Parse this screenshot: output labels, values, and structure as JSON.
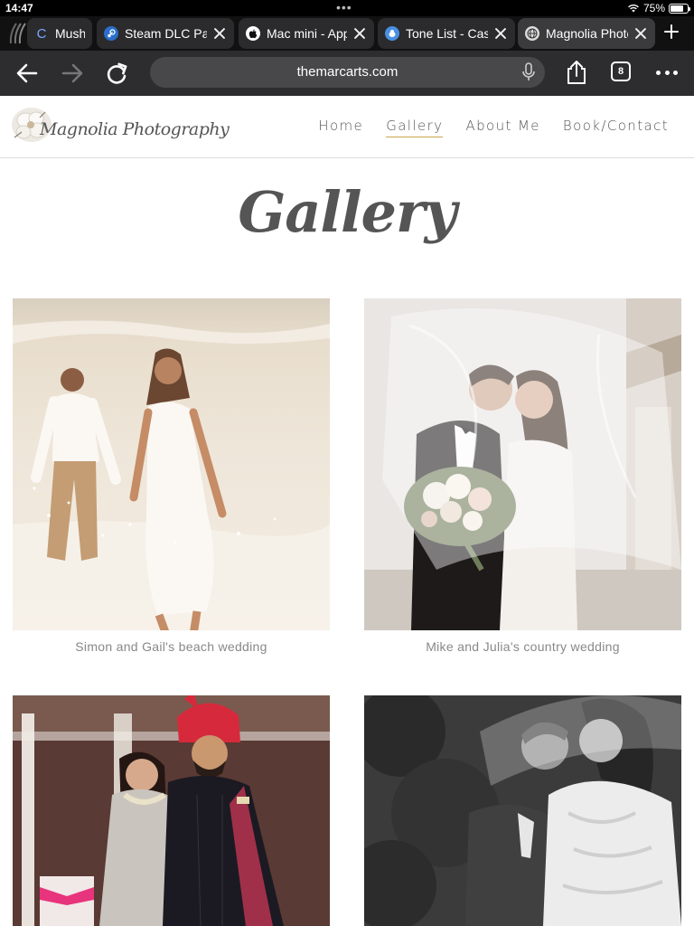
{
  "status_bar": {
    "time": "14:47",
    "battery": "75%"
  },
  "tabs": [
    {
      "label": "Mushro",
      "icon": "c-logo-icon",
      "active": false
    },
    {
      "label": "Steam DLC Pag",
      "icon": "steam-icon",
      "active": false
    },
    {
      "label": "Mac mini - App",
      "icon": "apple-icon",
      "active": false
    },
    {
      "label": "Tone List - Cas",
      "icon": "app-icon",
      "active": false
    },
    {
      "label": "Magnolia Photo",
      "icon": "globe-icon",
      "active": true
    }
  ],
  "toolbar": {
    "url": "themarcarts.com",
    "tab_count": "8"
  },
  "site": {
    "brand": "Magnolia Photography",
    "nav": [
      {
        "label": "Home",
        "current": false
      },
      {
        "label": "Gallery",
        "current": true
      },
      {
        "label": "About Me",
        "current": false
      },
      {
        "label": "Book/Contact",
        "current": false
      }
    ],
    "accent_color": "#c9a74d"
  },
  "page": {
    "title": "Gallery"
  },
  "gallery": [
    {
      "caption": "Simon and Gail's beach wedding",
      "scene": "beach-couple"
    },
    {
      "caption": "Mike and Julia's country wedding",
      "scene": "veil-kiss"
    },
    {
      "caption": "",
      "scene": "indian-couple"
    },
    {
      "caption": "",
      "scene": "bw-kiss"
    }
  ]
}
